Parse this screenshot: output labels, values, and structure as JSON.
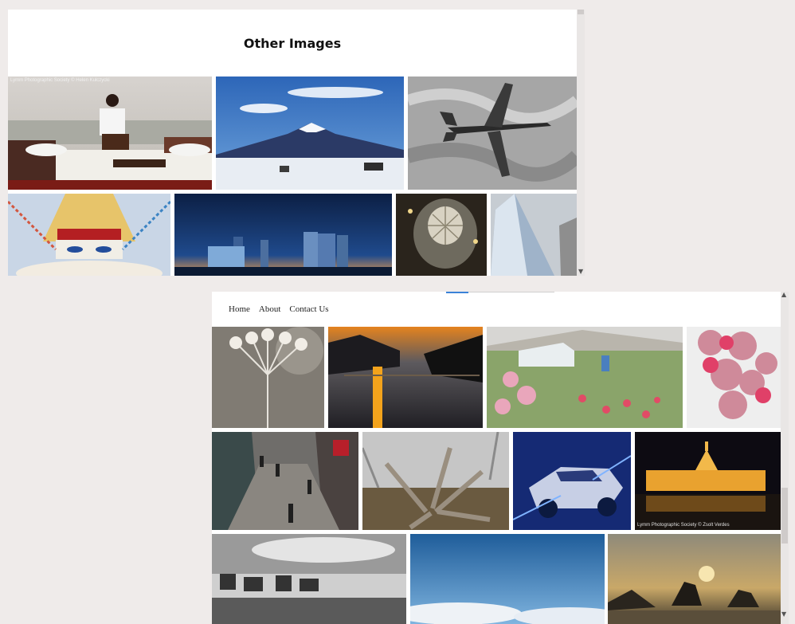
{
  "top_window": {
    "heading": "Other Images",
    "photos": [
      {
        "name": "photo-boat-meditation",
        "watermark": "Lymm Photographic Society © Helen Kulczycki"
      },
      {
        "name": "photo-mount-fuji",
        "watermark": ""
      },
      {
        "name": "photo-jet-aircraft",
        "watermark": ""
      },
      {
        "name": "photo-stupa-flags",
        "watermark": ""
      },
      {
        "name": "photo-mediacity-night",
        "watermark": ""
      },
      {
        "name": "photo-glass-dome",
        "watermark": ""
      },
      {
        "name": "photo-shard-building",
        "watermark": ""
      }
    ]
  },
  "bottom_window": {
    "nav": [
      {
        "label": "Home"
      },
      {
        "label": "About"
      },
      {
        "label": "Contact Us"
      }
    ],
    "photos": [
      {
        "name": "photo-seedhead",
        "watermark": ""
      },
      {
        "name": "photo-sunset-lake",
        "watermark": ""
      },
      {
        "name": "photo-greenhouse-garden",
        "watermark": ""
      },
      {
        "name": "photo-pink-roses",
        "watermark": ""
      },
      {
        "name": "photo-rainy-street",
        "watermark": ""
      },
      {
        "name": "photo-tree-root",
        "watermark": ""
      },
      {
        "name": "photo-sparkle-car",
        "watermark": ""
      },
      {
        "name": "photo-budapest-parliament",
        "watermark": "Lymm Photographic Society © Zsolt Verdes"
      },
      {
        "name": "photo-harbour-bw",
        "watermark": ""
      },
      {
        "name": "photo-blue-sky-clouds",
        "watermark": ""
      },
      {
        "name": "photo-sea-stacks-sunset",
        "watermark": ""
      }
    ]
  },
  "scroll_icons": {
    "up": "▲",
    "down": "▼"
  }
}
